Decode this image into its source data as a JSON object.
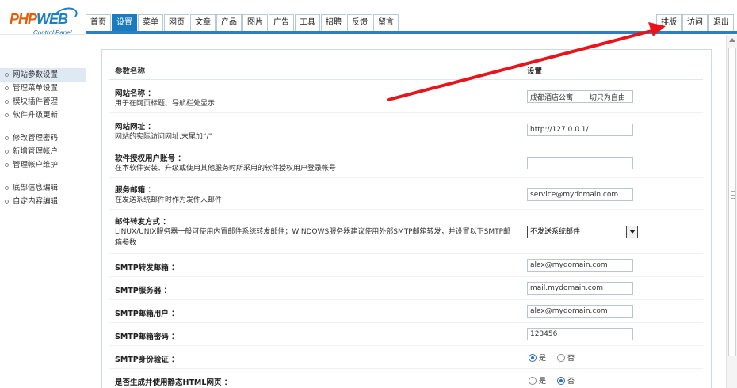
{
  "logo": {
    "part1": "PHP",
    "part2": "WEB",
    "subtitle": "Control Panel"
  },
  "top_nav": [
    {
      "label": "首页",
      "name": "tab-home"
    },
    {
      "label": "设置",
      "name": "tab-settings",
      "active": true
    },
    {
      "label": "菜单",
      "name": "tab-menu"
    },
    {
      "label": "网页",
      "name": "tab-webpages"
    },
    {
      "label": "文章",
      "name": "tab-articles"
    },
    {
      "label": "产品",
      "name": "tab-products"
    },
    {
      "label": "图片",
      "name": "tab-images"
    },
    {
      "label": "广告",
      "name": "tab-ads"
    },
    {
      "label": "工具",
      "name": "tab-tools"
    },
    {
      "label": "招聘",
      "name": "tab-jobs"
    },
    {
      "label": "反馈",
      "name": "tab-feedback"
    },
    {
      "label": "留言",
      "name": "tab-messages"
    }
  ],
  "right_nav": [
    {
      "label": "排版",
      "name": "layout-button"
    },
    {
      "label": "访问",
      "name": "visit-button"
    },
    {
      "label": "退出",
      "name": "logout-button"
    }
  ],
  "sidebar": [
    [
      {
        "label": "网站参数设置",
        "name": "sidebar-item-site-params",
        "active": true
      },
      {
        "label": "管理菜单设置",
        "name": "sidebar-item-menu-settings"
      },
      {
        "label": "模块插件管理",
        "name": "sidebar-item-plugins"
      },
      {
        "label": "软件升级更新",
        "name": "sidebar-item-upgrade"
      }
    ],
    [
      {
        "label": "修改管理密码",
        "name": "sidebar-item-change-password"
      },
      {
        "label": "新增管理帐户",
        "name": "sidebar-item-add-account"
      },
      {
        "label": "管理帐户维护",
        "name": "sidebar-item-account-maintenance"
      }
    ],
    [
      {
        "label": "底部信息编辑",
        "name": "sidebar-item-footer-edit"
      },
      {
        "label": "自定内容编辑",
        "name": "sidebar-item-custom-content"
      }
    ]
  ],
  "table": {
    "col_name": "参数名称",
    "col_setting": "设置"
  },
  "rows": [
    {
      "label": "网站名称 ：",
      "desc": "用于在网页标题、导航栏处显示",
      "type": "text",
      "value": "成都酒店公寓　 一切只为自由",
      "name": "site-name"
    },
    {
      "label": "网站网址 ：",
      "desc": "网站的实际访问网址,末尾加“/”",
      "type": "text",
      "value": "http://127.0.0.1/",
      "name": "site-url"
    },
    {
      "label": "软件授权用户账号 ：",
      "desc": "在本软件安装、升级或使用其他服务时所采用的软件授权用户登录帐号",
      "type": "text",
      "value": "",
      "name": "license-account"
    },
    {
      "label": "服务邮箱 ：",
      "desc": "在发送系统邮件时作为发件人邮件",
      "type": "text",
      "value": "service@mydomain.com",
      "name": "service-email"
    },
    {
      "label": "邮件转发方式 ：",
      "desc": "LINUX/UNIX服务器一般可使用内置邮件系统转发邮件；WINDOWS服务器建议使用外部SMTP邮箱转发，并设置以下SMTP邮箱参数",
      "type": "select",
      "value": "不发送系统邮件",
      "name": "mail-forward-mode"
    },
    {
      "label": "SMTP转发邮箱 ：",
      "desc": "",
      "type": "text",
      "value": "alex@mydomain.com",
      "name": "smtp-forward-email"
    },
    {
      "label": "SMTP服务器 ：",
      "desc": "",
      "type": "text",
      "value": "mail.mydomain.com",
      "name": "smtp-server"
    },
    {
      "label": "SMTP邮箱用户 ：",
      "desc": "",
      "type": "text",
      "value": "alex@mydomain.com",
      "name": "smtp-user"
    },
    {
      "label": "SMTP邮箱密码 ：",
      "desc": "",
      "type": "text",
      "value": "123456",
      "name": "smtp-password"
    },
    {
      "label": "SMTP身份验证 ：",
      "desc": "",
      "type": "radio",
      "options": [
        "是",
        "否"
      ],
      "selected": 0,
      "name": "smtp-auth"
    },
    {
      "label": "是否生成并使用静态HTML网页 ：",
      "desc": "",
      "type": "radio",
      "options": [
        "是",
        "否"
      ],
      "selected": 1,
      "name": "static-html"
    }
  ]
}
